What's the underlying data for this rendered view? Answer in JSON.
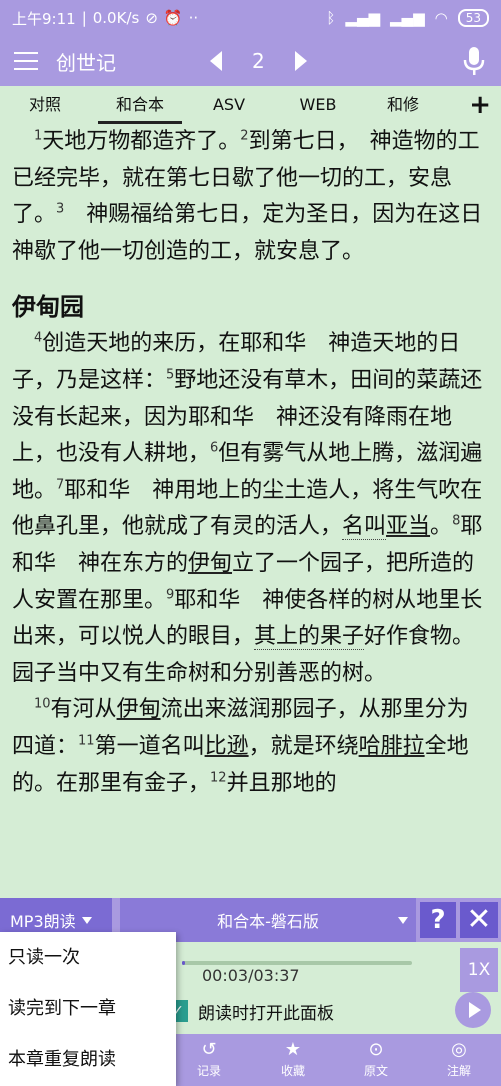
{
  "status": {
    "time": "上午9:11",
    "network": "0.0K/s",
    "battery": "53"
  },
  "appbar": {
    "book": "创世记",
    "chapter": "2"
  },
  "tabs": [
    "对照",
    "和合本",
    "ASV",
    "WEB",
    "和修"
  ],
  "active_tab": 1,
  "scripture": {
    "p1": {
      "v1n": "1",
      "v1": "天地万物都造齐了。",
      "v2n": "2",
      "v2": "到第七日，　神造物的工已经完毕，就在第七日歇了他一切的工，安息了。",
      "v3n": "3",
      "v3": "　神赐福给第七日，定为圣日，因为在这日　神歇了他一切创造的工，就安息了。"
    },
    "heading": "伊甸园",
    "p2": {
      "v4n": "4",
      "v4": "创造天地的来历，在耶和华　神造天地的日子，乃是这样：",
      "v5n": "5",
      "v5": "野地还没有草木，田间的菜蔬还没有长起来，因为耶和华　神还没有降雨在地上，也没有人耕地，",
      "v6n": "6",
      "v6": "但有雾气从地上腾，滋润遍地。",
      "v7n": "7",
      "v7a": "耶和华　神用地上的尘土造人，将生气吹在他鼻孔里，他就成了有灵的活人，",
      "v7b": "名叫",
      "v7c": "亚当",
      "v7d": "。",
      "v8n": "8",
      "v8a": "耶和华　神在东方的",
      "v8b": "伊甸",
      "v8c": "立了一个园子，把所造的人安置在那里。",
      "v9n": "9",
      "v9a": "耶和华　神使各样的树从地里长出来，可以悦人的眼目，",
      "v9b": "其上的果子",
      "v9c": "好作食物。园子当中又有生命树和分别善恶的树。"
    },
    "p3": {
      "v10n": "10",
      "v10a": "有河从",
      "v10b": "伊甸",
      "v10c": "流出来滋润那园子，从那里分为四道：",
      "v11n": "11",
      "v11a": "第一道名叫",
      "v11b": "比逊",
      "v11c": "，就是环绕",
      "v11d": "哈腓拉",
      "v11e": "全地的。在那里有金子，",
      "v12n": "12",
      "v12": "并且那地的"
    }
  },
  "panel": {
    "mp3_label": "MP3朗读",
    "version": "和合本-磐石版",
    "help": "?",
    "speed": "1X",
    "time": "00:03/03:37",
    "progress": 0.0138,
    "checkbox_label": "朗读时打开此面板"
  },
  "bottom_nav": [
    {
      "label": "记录",
      "icon": "history-icon"
    },
    {
      "label": "收藏",
      "icon": "star-icon"
    },
    {
      "label": "原文",
      "icon": "original-icon"
    },
    {
      "label": "注解",
      "icon": "notes-icon"
    }
  ],
  "popup": [
    "只读一次",
    "读完到下一章",
    "本章重复朗读"
  ]
}
